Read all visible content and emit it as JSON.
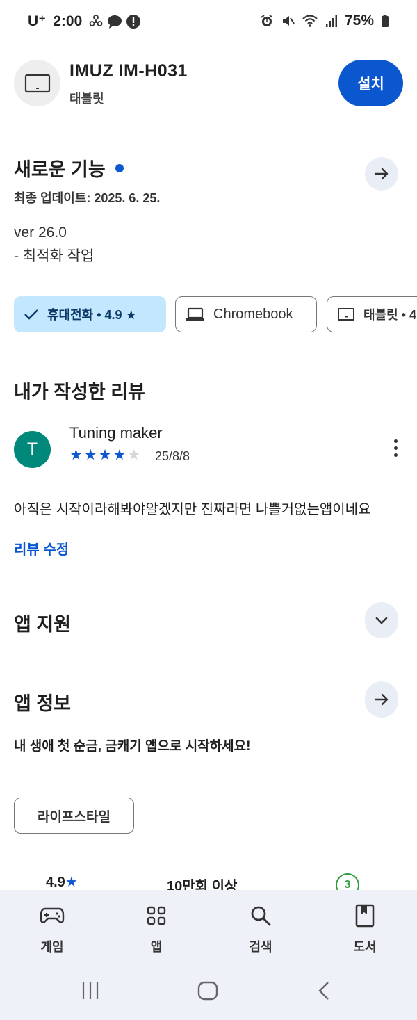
{
  "status_bar": {
    "carrier": "U⁺",
    "time": "2:00",
    "battery": "75%"
  },
  "app": {
    "title": "IMUZ IM-H031",
    "subtitle": "태블릿",
    "install_label": "설치"
  },
  "whats_new": {
    "title": "새로운 기능",
    "last_update": "최종 업데이트: 2025. 6. 25.",
    "version": "ver 26.0",
    "notes": "- 최적화 작업"
  },
  "device_chips": [
    {
      "label": "휴대전화 • 4.9 ★",
      "selected": true
    },
    {
      "label": "Chromebook",
      "selected": false
    },
    {
      "label": "태블릿 • 4",
      "selected": false
    }
  ],
  "my_review": {
    "title": "내가 작성한 리뷰",
    "avatar_letter": "T",
    "reviewer_name": "Tuning maker",
    "rating": 4,
    "max_rating": 5,
    "date": "25/8/8",
    "text": "아직은 시작이라해봐야알겠지만 진짜라면 나쁠거없는앱이네요",
    "edit_label": "리뷰 수정"
  },
  "app_support": {
    "title": "앱 지원"
  },
  "app_info": {
    "title": "앱 정보",
    "description": "내 생애 첫 순금, 금캐기 앱으로 시작하세요!",
    "category": "라이프스타일"
  },
  "stats": {
    "rating": "4.9",
    "installs": "10만회 이상",
    "age_rating": "3"
  },
  "bottom_nav": [
    {
      "label": "게임",
      "icon": "gamepad-icon"
    },
    {
      "label": "앱",
      "icon": "apps-grid-icon"
    },
    {
      "label": "검색",
      "icon": "search-icon"
    },
    {
      "label": "도서",
      "icon": "book-icon"
    }
  ],
  "colors": {
    "accent": "#0b57d0",
    "chip_selected_bg": "#c2e7ff",
    "avatar_bg": "#00897b",
    "age_badge": "#2e9d44",
    "nav_bg": "#eef1f8"
  }
}
